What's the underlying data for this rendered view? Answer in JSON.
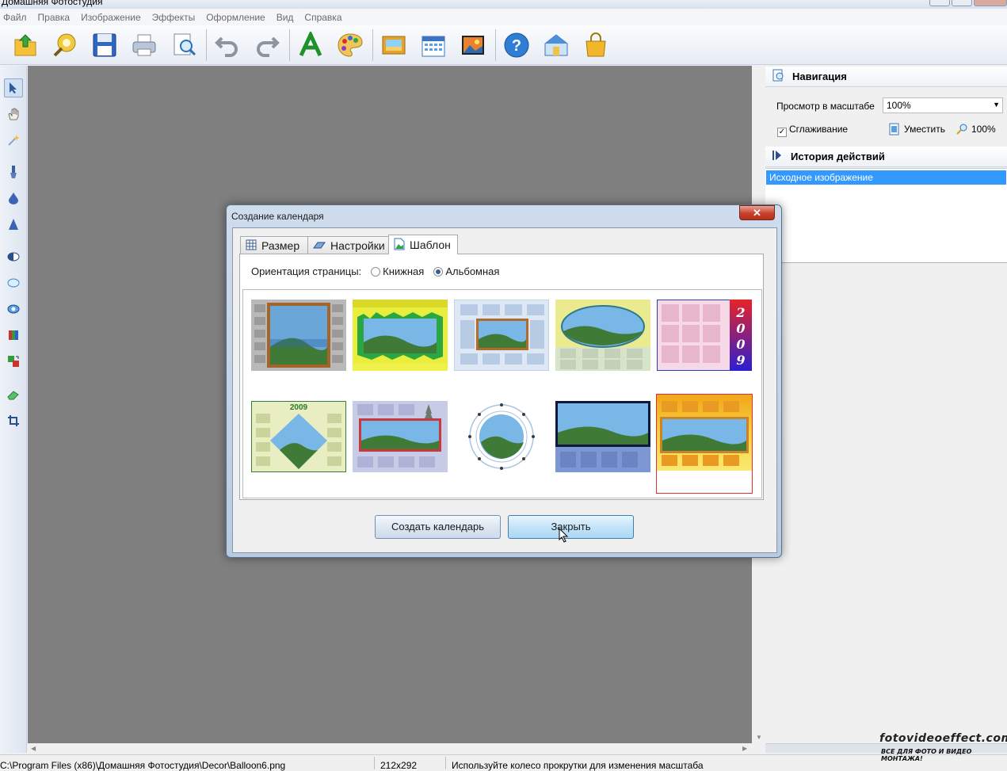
{
  "window": {
    "title": "Домашняя Фотостудия"
  },
  "menu": [
    "Файл",
    "Правка",
    "Изображение",
    "Эффекты",
    "Оформление",
    "Вид",
    "Справка"
  ],
  "toolbar_icons": [
    "open-icon",
    "enhance-icon",
    "save-icon",
    "print-icon",
    "preview-icon",
    "undo-icon",
    "redo-icon",
    "text-icon",
    "palette-icon",
    "frame-icon",
    "calendar-icon",
    "collage-icon",
    "help-icon",
    "home-icon",
    "shop-icon"
  ],
  "left_tools": [
    "select-icon",
    "hand-icon",
    "magic-wand-icon",
    "brush-icon",
    "drop-icon",
    "sharpen-icon",
    "contrast-icon",
    "lens-icon",
    "eye-icon",
    "rgb-icon",
    "swap-colors-icon",
    "eraser-icon",
    "crop-icon"
  ],
  "navigation": {
    "title": "Навигация",
    "zoom_label": "Просмотр в масштабе",
    "zoom_value": "100%",
    "smoothing_label": "Сглаживание",
    "fit_label": "Уместить",
    "actual_label": "100%"
  },
  "history": {
    "title": "История действий",
    "items": [
      "Исходное изображение"
    ]
  },
  "status": {
    "path": "C:\\Program Files (x86)\\Домашняя Фотостудия\\Decor\\Balloon6.png",
    "size": "212x292",
    "hint": "Используйте колесо прокрутки для изменения масштаба"
  },
  "watermark": {
    "line1": "fotovideoeffect.com",
    "line2": "ВСЕ ДЛЯ ФОТО И ВИДЕО МОНТАЖА!"
  },
  "dialog": {
    "title": "Создание календаря",
    "close_glyph": "✕",
    "tabs": [
      "Размер",
      "Настройки",
      "Шаблон"
    ],
    "active_tab": "Шаблон",
    "orientation_label": "Ориентация страницы:",
    "orientation_options": [
      "Книжная",
      "Альбомная"
    ],
    "orientation_selected": "Альбомная",
    "templates": [
      {
        "name": "template-1",
        "style": "gray-wood-frame"
      },
      {
        "name": "template-2",
        "style": "yellow-green-jagged"
      },
      {
        "name": "template-3",
        "style": "light-blue-grid"
      },
      {
        "name": "template-4",
        "style": "yellow-oval"
      },
      {
        "name": "template-5",
        "style": "pink-2009",
        "digits": [
          "2",
          "0",
          "0",
          "9"
        ]
      },
      {
        "name": "template-6",
        "style": "green-2009-diamond",
        "year": "2009"
      },
      {
        "name": "template-7",
        "style": "lavender-red-frame"
      },
      {
        "name": "template-8",
        "style": "white-circle"
      },
      {
        "name": "template-9",
        "style": "navy-frame"
      },
      {
        "name": "template-10",
        "style": "orange-gradient",
        "selected": true
      }
    ],
    "create_button": "Создать календарь",
    "close_button": "Закрыть"
  }
}
